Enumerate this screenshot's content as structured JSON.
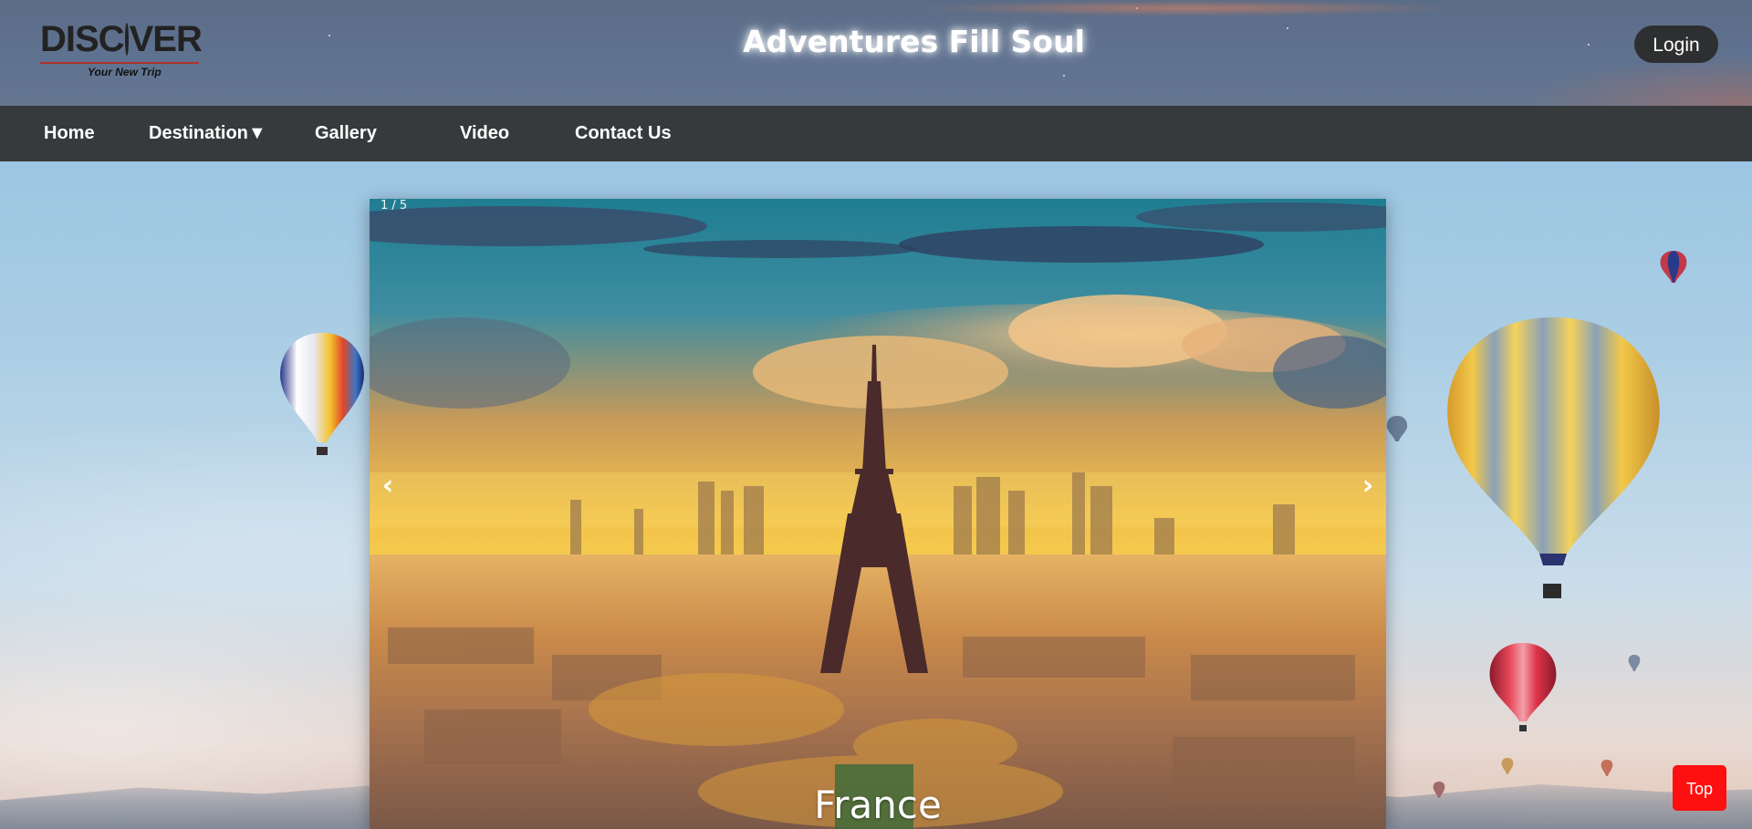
{
  "header": {
    "logo": {
      "word": "DISC",
      "word_end": "VER",
      "tagline": "Your New Trip"
    },
    "title": "Adventures Fill Soul",
    "login_label": "Login"
  },
  "nav": {
    "items": [
      {
        "label": "Home"
      },
      {
        "label": "Destination▼"
      },
      {
        "label": "Gallery"
      },
      {
        "label": "Video"
      },
      {
        "label": "Contact Us"
      }
    ]
  },
  "slider": {
    "counter": "1 / 5",
    "caption": "France",
    "prev_icon": "‹",
    "next_icon": "›"
  },
  "top_button": {
    "label": "Top",
    "color": "#ff1010"
  },
  "colors": {
    "nav_bg": "#363a3c",
    "header_bg": "#5f7290",
    "login_bg": "#2d2f30"
  }
}
